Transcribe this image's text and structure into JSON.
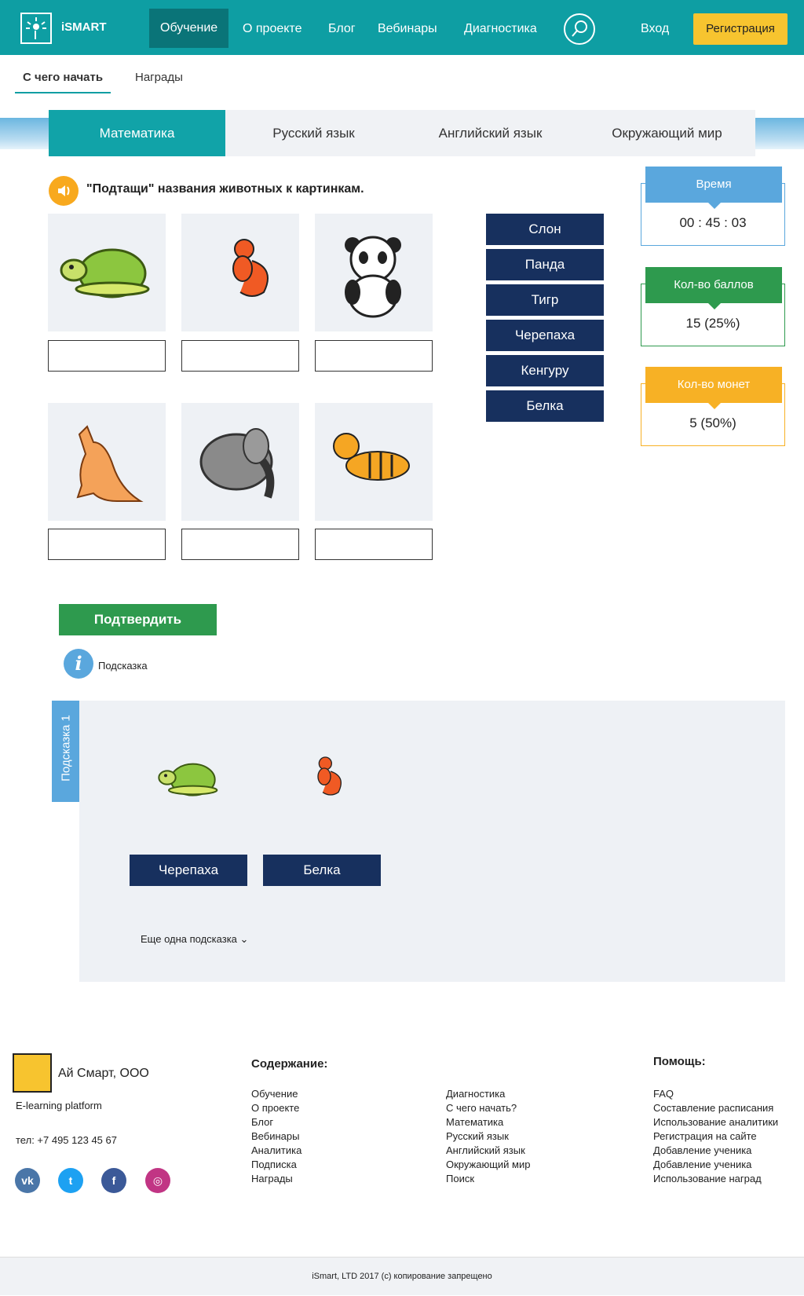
{
  "header": {
    "brand": "iSMART",
    "nav": [
      "Обучение",
      "О проекте",
      "Блог",
      "Вебинары",
      "Диагностика"
    ],
    "login": "Вход",
    "register": "Регистрация"
  },
  "subnav": {
    "items": [
      "С чего начать",
      "Награды"
    ]
  },
  "subjects": [
    "Математика",
    "Русский язык",
    "Английский язык",
    "Окружающий мир"
  ],
  "task": {
    "text": "\"Подтащи\" названия животных к картинкам."
  },
  "words": [
    "Слон",
    "Панда",
    "Тигр",
    "Черепаха",
    "Кенгуру",
    "Белка"
  ],
  "stats": {
    "time_label": "Время",
    "time_value": "00 : 45 : 03",
    "score_label": "Кол-во баллов",
    "score_value": "15 (25%)",
    "coins_label": "Кол-во монет",
    "coins_value": "5 (50%)"
  },
  "confirm": "Подтвердить",
  "hint": {
    "label": "Подсказка",
    "tab": "Подсказка 1",
    "words": [
      "Черепаха",
      "Белка"
    ],
    "more": "Еще одна подсказка"
  },
  "footer": {
    "company": "Ай Смарт, ООО",
    "platform": "E-learning platform",
    "phone": "тел: +7 495 123 45 67",
    "contents_title": "Содержание:",
    "help_title": "Помощь:",
    "col1": [
      "Обучение",
      "О проекте",
      "Блог",
      "Вебинары",
      "Аналитика",
      "Подписка",
      "Награды"
    ],
    "col2": [
      "Диагностика",
      "С чего начать?",
      "Математика",
      "Русский язык",
      "Английский язык",
      "Окружающий мир",
      "Поиск"
    ],
    "col3": [
      "FAQ",
      "Составление расписания",
      "Использование аналитики",
      "Регистрация на сайте",
      "Добавление ученика",
      "Добавление ученика",
      "Использование наград"
    ],
    "copyright": "iSmart, LTD 2017 (c) копирование запрещено"
  },
  "colors": {
    "teal": "#0e9ea3",
    "navy": "#17305e",
    "green": "#2e9a4e",
    "yellow": "#f7c42f",
    "blue": "#5aa7dd"
  }
}
